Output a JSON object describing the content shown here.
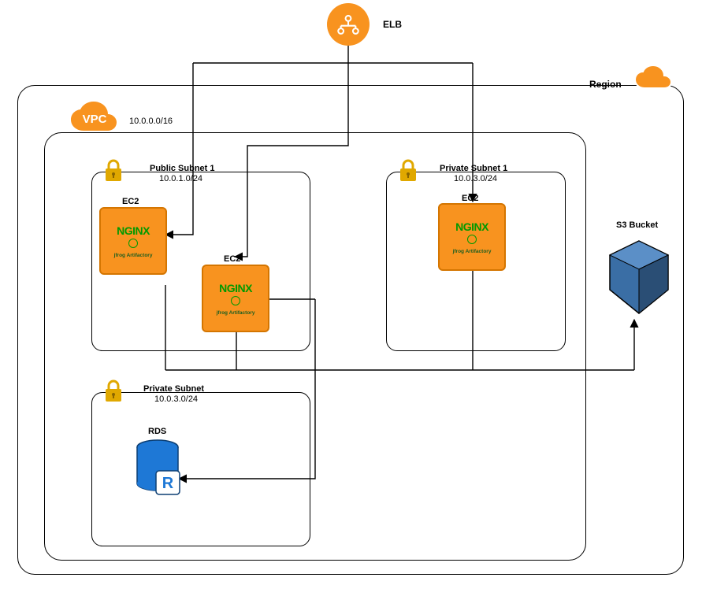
{
  "elb": {
    "label": "ELB"
  },
  "region": {
    "label": "Region"
  },
  "vpc": {
    "label": "VPC",
    "cidr": "10.0.0.0/16"
  },
  "subnet1": {
    "title": "Public Subnet 1",
    "cidr": "10.0.1.0/24"
  },
  "subnet2": {
    "title": "Private Subnet 1",
    "cidr": "10.0.3.0/24"
  },
  "subnet3": {
    "title": "Private Subnet",
    "cidr": "10.0.3.0/24"
  },
  "ec2_label": "EC2",
  "nginx_label": "NGINX",
  "jfrog_label": "jfrog Artifactory",
  "s3": {
    "label": "S3 Bucket"
  },
  "rds": {
    "label": "RDS",
    "letter": "R"
  },
  "icons": {
    "elb": "load-balancer-icon",
    "cloud": "cloud-icon",
    "lock": "lock-icon",
    "s3": "s3-bucket-icon",
    "rds": "rds-icon"
  },
  "colors": {
    "orange": "#f8931f",
    "orange_dark": "#d47500",
    "gold": "#e0a800",
    "green": "#009900",
    "s3_blue": "#3a6ea5",
    "s3_blue_dark": "#2a4e75",
    "rds_blue": "#1e78d6"
  }
}
